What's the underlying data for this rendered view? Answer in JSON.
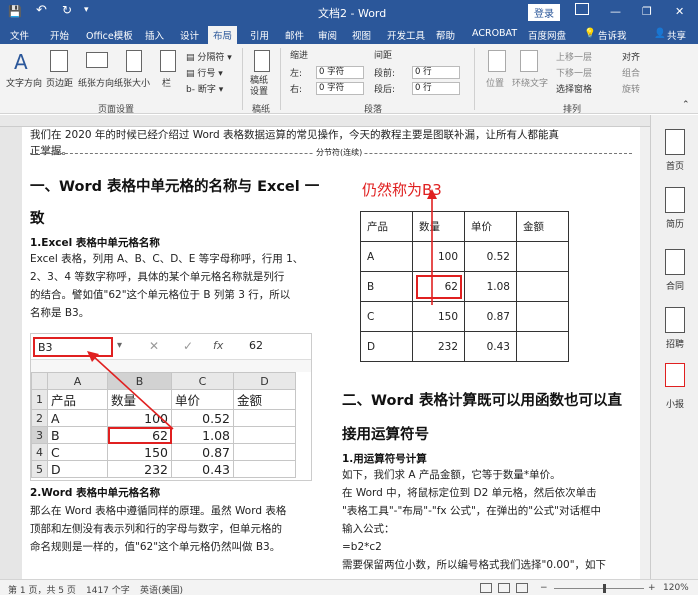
{
  "titlebar": {
    "save_icon": "save-icon",
    "undo": "↶",
    "redo": "↻",
    "title": "文档2 - Word",
    "login": "登录",
    "minimize": "—",
    "restore": "❐",
    "close": "✕"
  },
  "tabs": [
    "文件",
    "开始",
    "Office模板",
    "插入",
    "设计",
    "布局",
    "引用",
    "邮件",
    "审阅",
    "视图",
    "开发工具",
    "帮助",
    "ACROBAT",
    "百度网盘"
  ],
  "active_tab": "布局",
  "tell_me": "告诉我",
  "share": "共享",
  "ribbon": {
    "page_setup": {
      "text_dir": "文字方向",
      "margins": "页边距",
      "orientation": "纸张方向",
      "size": "纸张大小",
      "columns": "栏",
      "breaks": "分隔符",
      "line_numbers": "行号",
      "hyphenation": "断字",
      "label": "页面设置"
    },
    "draft": {
      "paper": "稿纸设置",
      "label": "稿纸"
    },
    "paragraph": {
      "indent": "缩进",
      "spacing": "间距",
      "left": "左:",
      "right": "右:",
      "before": "段前:",
      "after": "段后:",
      "left_val": "0 字符",
      "right_val": "0 字符",
      "before_val": "0 行",
      "after_val": "0 行",
      "label": "段落"
    },
    "arrange": {
      "position": "位置",
      "wrap": "环绕文字",
      "bring_forward": "上移一层",
      "send_backward": "下移一层",
      "selection_pane": "选择窗格",
      "align": "对齐",
      "group": "组合",
      "rotate": "旋转",
      "label": "排列"
    }
  },
  "document": {
    "top_line": "我们在 2020 年的时候已经介绍过 Word 表格数据运算的常见操作，今天的教程主要是图联补漏，让所有人都能真",
    "top_line2": "正掌握。",
    "section_break": "分节符(连续)",
    "h1a": "一、Word 表格中单元格的名称与 Excel 一",
    "h1a2": "致",
    "h2a": "1.Excel 表格中单元格名称",
    "p1": [
      "Excel 表格，列用 A、B、C、D、E 等字母称呼，行用 1、",
      "2、3、4 等数字称呼，具体的某个单元格名称就是列行",
      "的结合。譬如值\"62\"这个单元格位于 B 列第 3 行，所以",
      "名称是 B3。"
    ],
    "h2b": "2.Word 表格中单元格名称",
    "p2": [
      "那么在 Word 表格中遵循同样的原理。虽然 Word 表格",
      "顶部和左侧没有表示列和行的字母与数字，但单元格的",
      "命名规则是一样的，值\"62\"这个单元格仍然叫做 B3。"
    ],
    "callout": "仍然称为B3",
    "word_table": [
      [
        "产品",
        "数量",
        "单价",
        "金额"
      ],
      [
        "A",
        "100",
        "0.52",
        ""
      ],
      [
        "B",
        "62",
        "1.08",
        ""
      ],
      [
        "C",
        "150",
        "0.87",
        ""
      ],
      [
        "D",
        "232",
        "0.43",
        ""
      ]
    ],
    "h1b": "二、Word 表格计算既可以用函数也可以直",
    "h1b2": "接用运算符号",
    "h2c": "1.用运算符号计算",
    "p3": [
      "如下，我们求 A 产品金额，它等于数量*单价。",
      "在 Word 中，将鼠标定位到 D2 单元格，然后依次单击",
      "\"表格工具\"-\"布局\"-\"fx 公式\"，在弹出的\"公式\"对话框中",
      "输入公式：",
      "=b2*c2",
      "需要保留两位小数，所以编号格式我们选择\"0.00\"，如下"
    ]
  },
  "excel": {
    "namebox": "B3",
    "formula_value": "62",
    "fx": "fx",
    "col_headers": [
      "",
      "A",
      "B",
      "C",
      "D"
    ],
    "rows": [
      [
        "1",
        "产品",
        "数量",
        "单价",
        "金额"
      ],
      [
        "2",
        "A",
        "100",
        "0.52",
        ""
      ],
      [
        "3",
        "B",
        "62",
        "1.08",
        ""
      ],
      [
        "4",
        "C",
        "150",
        "0.87",
        ""
      ],
      [
        "5",
        "D",
        "232",
        "0.43",
        ""
      ]
    ]
  },
  "right_panel": [
    "首页",
    "简历",
    "合同",
    "招聘",
    "小报"
  ],
  "status": {
    "page": "第 1 页，共 5 页",
    "words": "1417 个字",
    "lang": "英语(美国)",
    "zoom": "120%",
    "minus": "−",
    "plus": "+"
  },
  "colors": {
    "title_bar": "#2b579a",
    "red": "#e02020"
  }
}
